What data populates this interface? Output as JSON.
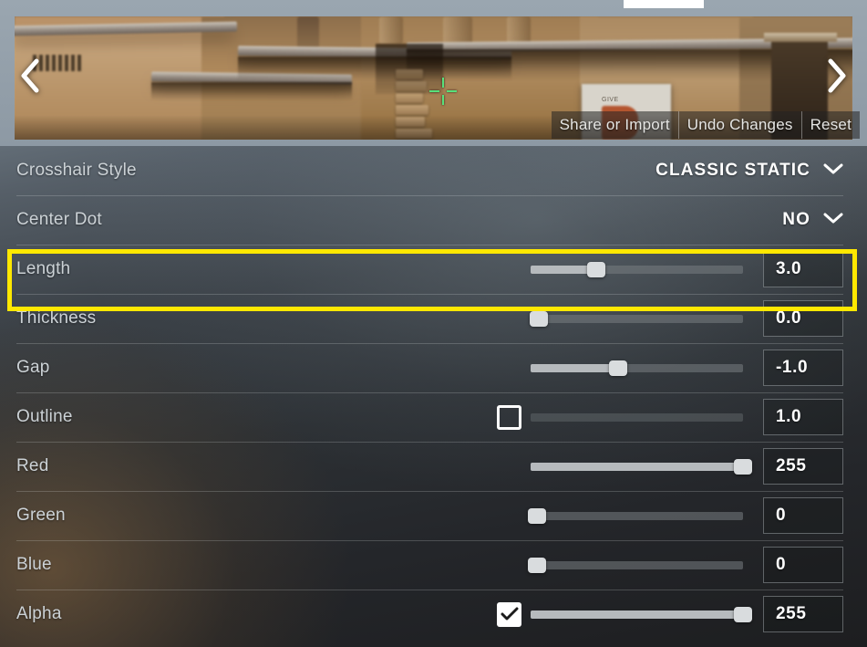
{
  "preview": {
    "tab_indicator": "active-tab-marker",
    "prev_arrow_icon": "chevron-left-icon",
    "next_arrow_icon": "chevron-right-icon",
    "crosshair_icon": "crosshair-preview",
    "sign_text": "GIVE",
    "actions": [
      {
        "label": "Share or Import",
        "name": "share-or-import-button"
      },
      {
        "label": "Undo Changes",
        "name": "undo-changes-button"
      },
      {
        "label": "Reset",
        "name": "reset-button"
      }
    ]
  },
  "settings": {
    "rows": [
      {
        "label": "Crosshair Style",
        "control": "dropdown",
        "value": "CLASSIC STATIC",
        "icon": "chevron-down-icon"
      },
      {
        "label": "Center Dot",
        "control": "dropdown",
        "value": "NO",
        "icon": "chevron-down-icon"
      },
      {
        "label": "Length",
        "control": "slider",
        "value": "3.0",
        "fill_percent": 31,
        "checkbox": null,
        "disabled": false,
        "highlighted": true
      },
      {
        "label": "Thickness",
        "control": "slider",
        "value": "0.0",
        "fill_percent": 4,
        "checkbox": null,
        "disabled": false,
        "highlighted": false
      },
      {
        "label": "Gap",
        "control": "slider",
        "value": "-1.0",
        "fill_percent": 41,
        "checkbox": null,
        "disabled": false,
        "highlighted": false
      },
      {
        "label": "Outline",
        "control": "slider",
        "value": "1.0",
        "fill_percent": 0,
        "checkbox": "unchecked",
        "disabled": true,
        "highlighted": false
      },
      {
        "label": "Red",
        "control": "slider",
        "value": "255",
        "fill_percent": 100,
        "checkbox": null,
        "disabled": false,
        "highlighted": false
      },
      {
        "label": "Green",
        "control": "slider",
        "value": "0",
        "fill_percent": 3,
        "checkbox": null,
        "disabled": false,
        "highlighted": false
      },
      {
        "label": "Blue",
        "control": "slider",
        "value": "0",
        "fill_percent": 3,
        "checkbox": null,
        "disabled": false,
        "highlighted": false
      },
      {
        "label": "Alpha",
        "control": "slider",
        "value": "255",
        "fill_percent": 100,
        "checkbox": "checked",
        "disabled": false,
        "highlighted": false
      }
    ]
  },
  "colors": {
    "highlight": "#ffe800",
    "crosshair": "#57e07a",
    "slider_fill": "#b6babd",
    "text": "#ccd2d6"
  }
}
